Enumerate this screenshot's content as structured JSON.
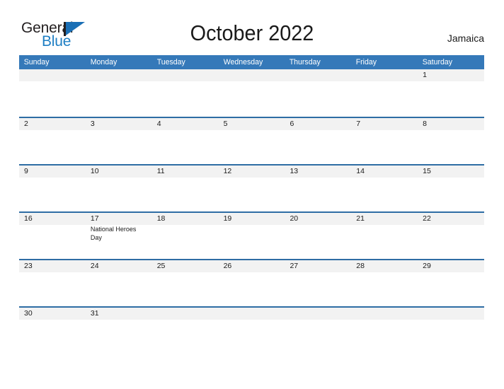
{
  "brand": {
    "name_part1": "General",
    "name_part2": "Blue",
    "flag_icon": "flag-triangle-icon",
    "colors": {
      "general_text": "#231f20",
      "blue_text": "#1f7fc4",
      "flag": "#1a6fb5"
    }
  },
  "header": {
    "title": "October 2022",
    "country": "Jamaica"
  },
  "calendar": {
    "colors": {
      "weekday_header_bg": "#3579b9",
      "weekday_header_text": "#ffffff",
      "week_separator": "#2e6da4",
      "day_band_bg": "#f2f2f2",
      "body_bg": "#ffffff",
      "text": "#1a1a1a"
    },
    "weekdays": [
      "Sunday",
      "Monday",
      "Tuesday",
      "Wednesday",
      "Thursday",
      "Friday",
      "Saturday"
    ],
    "weeks": [
      {
        "days": [
          {
            "num": "",
            "events": []
          },
          {
            "num": "",
            "events": []
          },
          {
            "num": "",
            "events": []
          },
          {
            "num": "",
            "events": []
          },
          {
            "num": "",
            "events": []
          },
          {
            "num": "",
            "events": []
          },
          {
            "num": "1",
            "events": []
          }
        ]
      },
      {
        "days": [
          {
            "num": "2",
            "events": []
          },
          {
            "num": "3",
            "events": []
          },
          {
            "num": "4",
            "events": []
          },
          {
            "num": "5",
            "events": []
          },
          {
            "num": "6",
            "events": []
          },
          {
            "num": "7",
            "events": []
          },
          {
            "num": "8",
            "events": []
          }
        ]
      },
      {
        "days": [
          {
            "num": "9",
            "events": []
          },
          {
            "num": "10",
            "events": []
          },
          {
            "num": "11",
            "events": []
          },
          {
            "num": "12",
            "events": []
          },
          {
            "num": "13",
            "events": []
          },
          {
            "num": "14",
            "events": []
          },
          {
            "num": "15",
            "events": []
          }
        ]
      },
      {
        "days": [
          {
            "num": "16",
            "events": []
          },
          {
            "num": "17",
            "events": [
              "National Heroes",
              "Day"
            ]
          },
          {
            "num": "18",
            "events": []
          },
          {
            "num": "19",
            "events": []
          },
          {
            "num": "20",
            "events": []
          },
          {
            "num": "21",
            "events": []
          },
          {
            "num": "22",
            "events": []
          }
        ]
      },
      {
        "days": [
          {
            "num": "23",
            "events": []
          },
          {
            "num": "24",
            "events": []
          },
          {
            "num": "25",
            "events": []
          },
          {
            "num": "26",
            "events": []
          },
          {
            "num": "27",
            "events": []
          },
          {
            "num": "28",
            "events": []
          },
          {
            "num": "29",
            "events": []
          }
        ]
      },
      {
        "days": [
          {
            "num": "30",
            "events": []
          },
          {
            "num": "31",
            "events": []
          },
          {
            "num": "",
            "events": []
          },
          {
            "num": "",
            "events": []
          },
          {
            "num": "",
            "events": []
          },
          {
            "num": "",
            "events": []
          },
          {
            "num": "",
            "events": []
          }
        ]
      }
    ]
  }
}
